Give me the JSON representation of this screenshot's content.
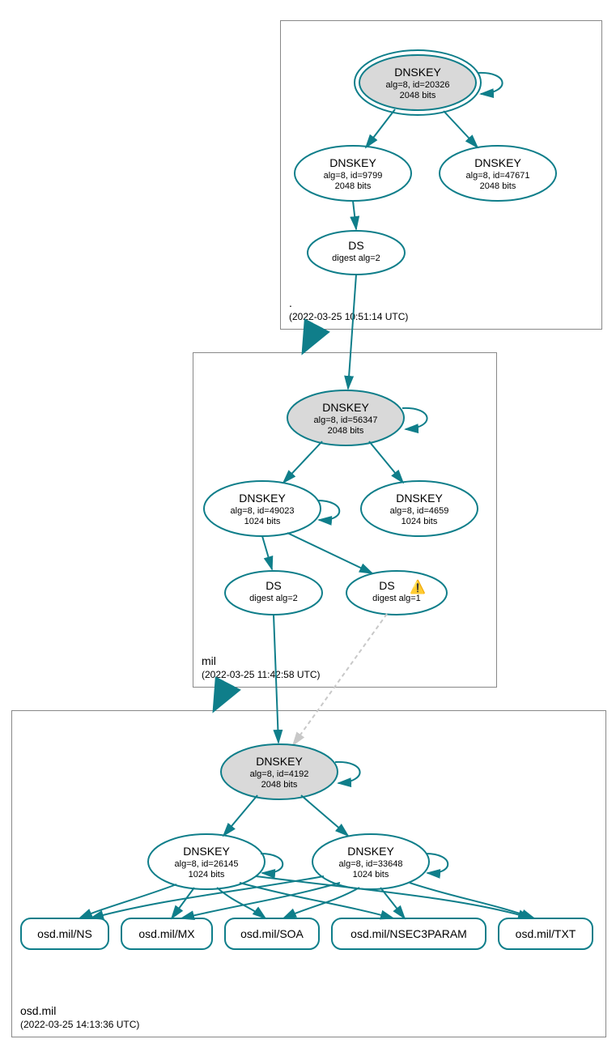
{
  "zones": {
    "root": {
      "name": ".",
      "timestamp": "(2022-03-25 10:51:14 UTC)"
    },
    "mil": {
      "name": "mil",
      "timestamp": "(2022-03-25 11:42:58 UTC)"
    },
    "osd": {
      "name": "osd.mil",
      "timestamp": "(2022-03-25 14:13:36 UTC)"
    }
  },
  "nodes": {
    "root_ksk": {
      "title": "DNSKEY",
      "line2": "alg=8, id=20326",
      "line3": "2048 bits"
    },
    "root_zsk": {
      "title": "DNSKEY",
      "line2": "alg=8, id=9799",
      "line3": "2048 bits"
    },
    "root_other": {
      "title": "DNSKEY",
      "line2": "alg=8, id=47671",
      "line3": "2048 bits"
    },
    "root_ds": {
      "title": "DS",
      "line2": "digest alg=2"
    },
    "mil_ksk": {
      "title": "DNSKEY",
      "line2": "alg=8, id=56347",
      "line3": "2048 bits"
    },
    "mil_zsk": {
      "title": "DNSKEY",
      "line2": "alg=8, id=49023",
      "line3": "1024 bits"
    },
    "mil_other": {
      "title": "DNSKEY",
      "line2": "alg=8, id=4659",
      "line3": "1024 bits"
    },
    "mil_ds2": {
      "title": "DS",
      "line2": "digest alg=2"
    },
    "mil_ds1": {
      "title": "DS",
      "line2": "digest alg=1",
      "warn": "⚠️"
    },
    "osd_ksk": {
      "title": "DNSKEY",
      "line2": "alg=8, id=4192",
      "line3": "2048 bits"
    },
    "osd_zsk1": {
      "title": "DNSKEY",
      "line2": "alg=8, id=26145",
      "line3": "1024 bits"
    },
    "osd_zsk2": {
      "title": "DNSKEY",
      "line2": "alg=8, id=33648",
      "line3": "1024 bits"
    },
    "rr_ns": {
      "label": "osd.mil/NS"
    },
    "rr_mx": {
      "label": "osd.mil/MX"
    },
    "rr_soa": {
      "label": "osd.mil/SOA"
    },
    "rr_nsec": {
      "label": "osd.mil/NSEC3PARAM"
    },
    "rr_txt": {
      "label": "osd.mil/TXT"
    }
  }
}
